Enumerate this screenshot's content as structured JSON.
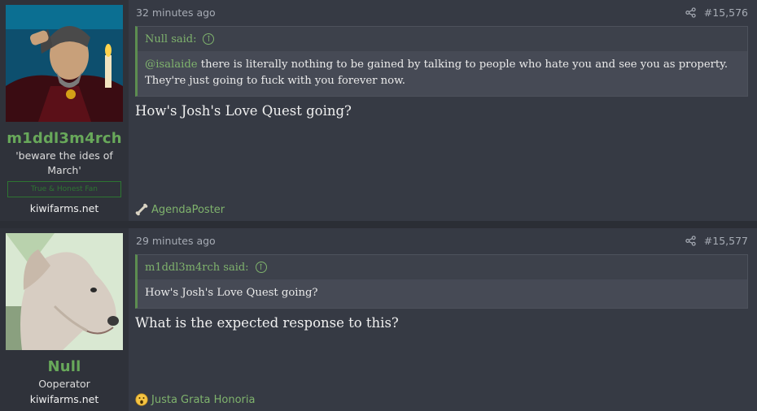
{
  "posts": [
    {
      "username": "m1ddl3m4rch",
      "user_title": "'beware the ides of March'",
      "user_banner": "True & Honest Fan",
      "site": "kiwifarms.net",
      "timestamp": "32 minutes ago",
      "post_number": "#15,576",
      "quote_author": "Null said:",
      "quote_mention": "@isalaide",
      "quote_text": " there is literally nothing to be gained by talking to people who hate you and see you as property. They're just going to fuck with you forever now.",
      "body": "How's Josh's Love Quest going?",
      "reaction_label": "AgendaPoster",
      "reaction_icon": "bone-icon"
    },
    {
      "username": "Null",
      "user_title": "Ooperator",
      "site": "kiwifarms.net",
      "timestamp": "29 minutes ago",
      "post_number": "#15,577",
      "quote_author": "m1ddl3m4rch said:",
      "quote_text": "How's Josh's Love Quest going?",
      "body": "What is the expected response to this?",
      "reaction_label": "Justa Grata Honoria",
      "reaction_icon": "surprised-emoji-icon"
    }
  ],
  "colors": {
    "accent_green": "#68a85a",
    "post_bg": "#363a44",
    "user_bg": "#2f323a"
  }
}
